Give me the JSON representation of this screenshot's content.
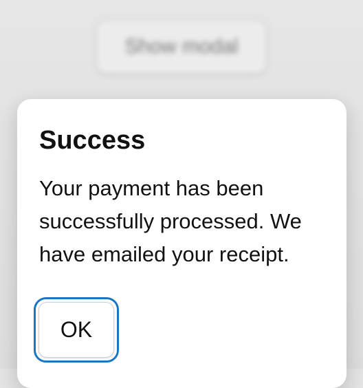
{
  "background": {
    "show_modal_label": "Show modal"
  },
  "modal": {
    "title": "Success",
    "message": "Your payment has been successfully processed. We have emailed your receipt.",
    "ok_label": "OK",
    "focus_color": "#1a76c2"
  }
}
